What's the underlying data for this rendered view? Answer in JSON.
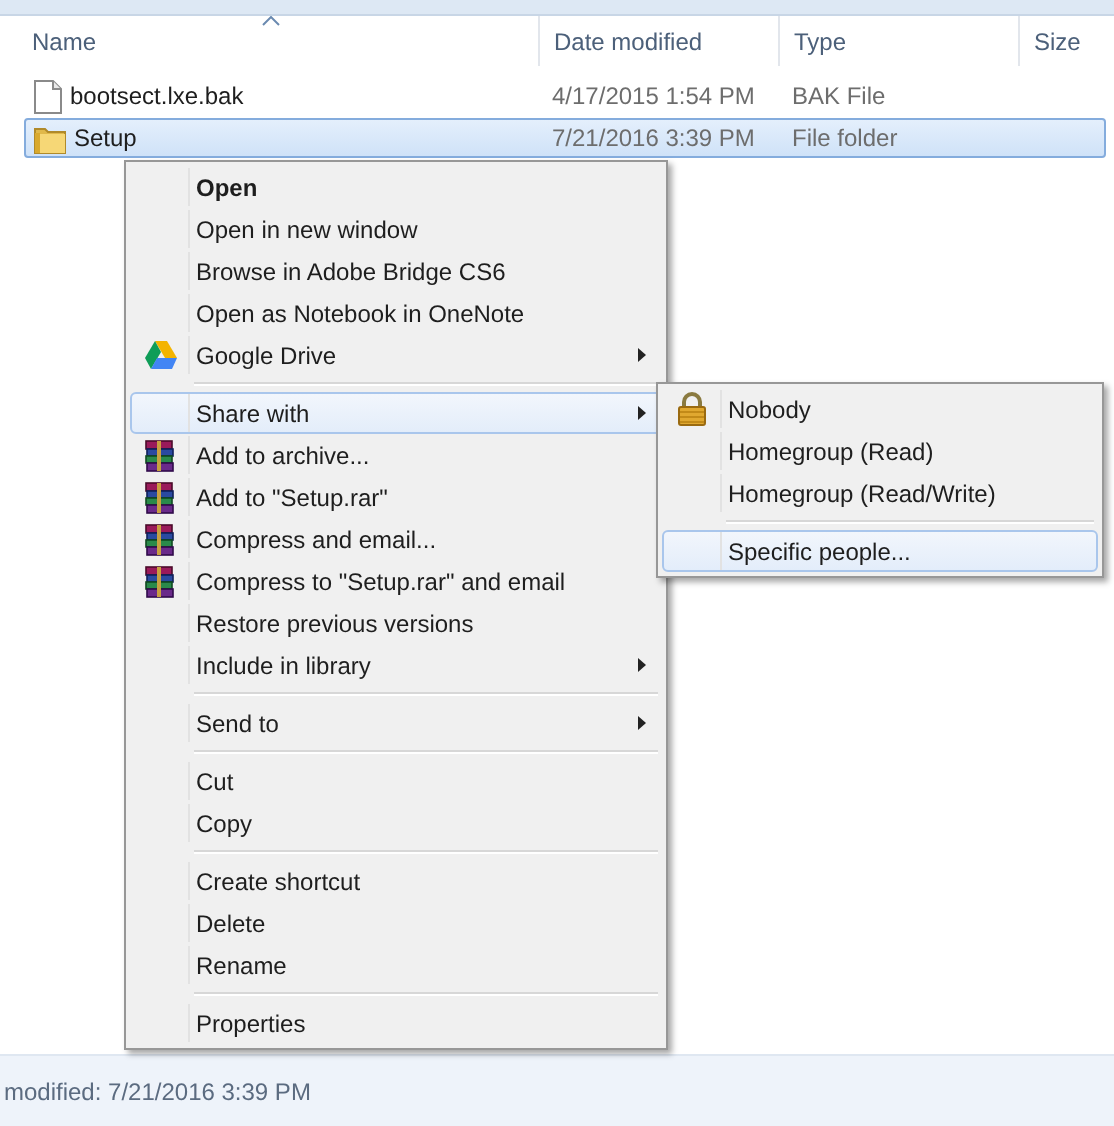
{
  "columns": [
    {
      "label": "Name",
      "sorted": true
    },
    {
      "label": "Date modified",
      "sorted": false
    },
    {
      "label": "Type",
      "sorted": false
    },
    {
      "label": "Size",
      "sorted": false
    }
  ],
  "files": [
    {
      "kind": "file",
      "name": "bootsect.lxe.bak",
      "date": "4/17/2015 1:54 PM",
      "type": "BAK File",
      "selected": false
    },
    {
      "kind": "folder",
      "name": "Setup",
      "date": "7/21/2016 3:39 PM",
      "type": "File folder",
      "selected": true
    }
  ],
  "context_menu": [
    {
      "kind": "default",
      "label": "Open",
      "submenu": false,
      "selected": false
    },
    {
      "kind": "plain",
      "label": "Open in new window",
      "submenu": false,
      "selected": false
    },
    {
      "kind": "plain",
      "label": "Browse in Adobe Bridge CS6",
      "submenu": false,
      "selected": false
    },
    {
      "kind": "plain",
      "label": "Open as Notebook in OneNote",
      "submenu": false,
      "selected": false
    },
    {
      "kind": "drive",
      "label": "Google Drive",
      "submenu": true,
      "selected": false
    },
    {
      "kind": "separator"
    },
    {
      "kind": "plain",
      "label": "Share with",
      "submenu": true,
      "selected": true
    },
    {
      "kind": "archive",
      "label": "Add to archive...",
      "submenu": false,
      "selected": false
    },
    {
      "kind": "archive",
      "label": "Add to \"Setup.rar\"",
      "submenu": false,
      "selected": false
    },
    {
      "kind": "archive",
      "label": "Compress and email...",
      "submenu": false,
      "selected": false
    },
    {
      "kind": "archive",
      "label": "Compress to \"Setup.rar\" and email",
      "submenu": false,
      "selected": false
    },
    {
      "kind": "plain",
      "label": "Restore previous versions",
      "submenu": false,
      "selected": false
    },
    {
      "kind": "plain",
      "label": "Include in library",
      "submenu": true,
      "selected": false
    },
    {
      "kind": "separator"
    },
    {
      "kind": "plain",
      "label": "Send to",
      "submenu": true,
      "selected": false
    },
    {
      "kind": "separator"
    },
    {
      "kind": "plain",
      "label": "Cut",
      "submenu": false,
      "selected": false
    },
    {
      "kind": "plain",
      "label": "Copy",
      "submenu": false,
      "selected": false
    },
    {
      "kind": "separator"
    },
    {
      "kind": "plain",
      "label": "Create shortcut",
      "submenu": false,
      "selected": false
    },
    {
      "kind": "plain",
      "label": "Delete",
      "submenu": false,
      "selected": false
    },
    {
      "kind": "plain",
      "label": "Rename",
      "submenu": false,
      "selected": false
    },
    {
      "kind": "separator"
    },
    {
      "kind": "plain",
      "label": "Properties",
      "submenu": false,
      "selected": false
    }
  ],
  "share_submenu": [
    {
      "kind": "lock",
      "label": "Nobody",
      "submenu": false,
      "selected": false
    },
    {
      "kind": "plain",
      "label": "Homegroup (Read)",
      "submenu": false,
      "selected": false
    },
    {
      "kind": "plain",
      "label": "Homegroup (Read/Write)",
      "submenu": false,
      "selected": false
    },
    {
      "kind": "separator"
    },
    {
      "kind": "plain",
      "label": "Specific people...",
      "submenu": false,
      "selected": true
    }
  ],
  "status_bar": "modified: 7/21/2016 3:39 PM"
}
